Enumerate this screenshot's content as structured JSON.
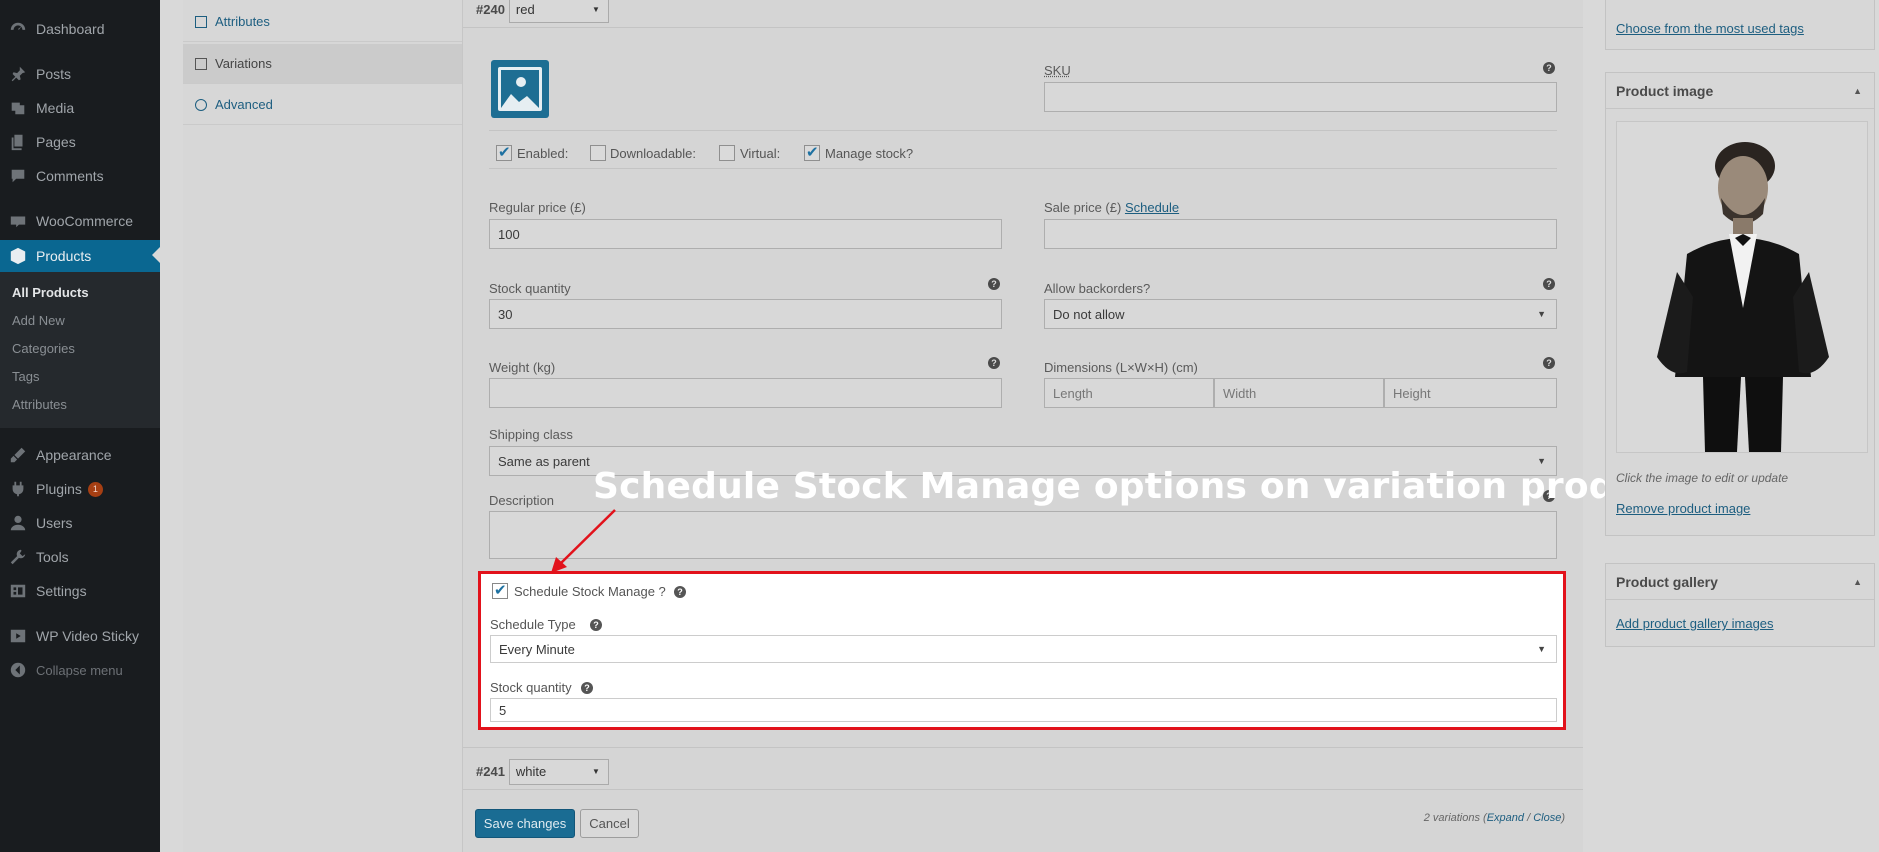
{
  "sidebar": {
    "items": [
      {
        "label": "Dashboard",
        "icon": "dashboard-icon"
      },
      {
        "label": "Posts",
        "icon": "pin-icon"
      },
      {
        "label": "Media",
        "icon": "media-icon"
      },
      {
        "label": "Pages",
        "icon": "pages-icon"
      },
      {
        "label": "Comments",
        "icon": "comments-icon"
      },
      {
        "label": "WooCommerce",
        "icon": "woocommerce-icon"
      },
      {
        "label": "Products",
        "icon": "products-icon"
      }
    ],
    "submenu": [
      "All Products",
      "Add New",
      "Categories",
      "Tags",
      "Attributes"
    ],
    "lower_items": [
      {
        "label": "Appearance",
        "icon": "brush-icon"
      },
      {
        "label": "Plugins",
        "icon": "plugin-icon",
        "badge": "1"
      },
      {
        "label": "Users",
        "icon": "users-icon"
      },
      {
        "label": "Tools",
        "icon": "wrench-icon"
      },
      {
        "label": "Settings",
        "icon": "settings-icon"
      },
      {
        "label": "WP Video Sticky",
        "icon": "video-icon"
      }
    ],
    "collapse_label": "Collapse menu"
  },
  "product_tabs": [
    {
      "label": "Attributes",
      "icon": "list-icon"
    },
    {
      "label": "Variations",
      "icon": "grid-icon"
    },
    {
      "label": "Advanced",
      "icon": "gear-icon"
    }
  ],
  "variation_240": {
    "number": "#240",
    "attribute_value": "red",
    "sku_label": "SKU",
    "sku_value": "",
    "checkboxes": [
      {
        "label": "Enabled:",
        "checked": true
      },
      {
        "label": "Downloadable:",
        "checked": false
      },
      {
        "label": "Virtual:",
        "checked": false
      },
      {
        "label": "Manage stock?",
        "checked": true
      }
    ],
    "regular_price_label": "Regular price (£)",
    "regular_price": "100",
    "sale_price_label": "Sale price (£)",
    "schedule_link": "Schedule",
    "sale_price": "",
    "stock_qty_label": "Stock quantity",
    "stock_qty": "30",
    "backorders_label": "Allow backorders?",
    "backorders_value": "Do not allow",
    "weight_label": "Weight (kg)",
    "weight_value": "",
    "dimensions_label": "Dimensions (L×W×H) (cm)",
    "length_placeholder": "Length",
    "width_placeholder": "Width",
    "height_placeholder": "Height",
    "shipping_label": "Shipping class",
    "shipping_value": "Same as parent",
    "description_label": "Description",
    "description_value": ""
  },
  "schedule": {
    "checkbox_label": "Schedule Stock Manage ?",
    "checked": true,
    "type_label": "Schedule Type",
    "type_value": "Every Minute",
    "stock_label": "Stock quantity",
    "stock_value": "5"
  },
  "annotation_text": "Schedule Stock Manage options on variation product",
  "variation_241": {
    "number": "#241",
    "attribute_value": "white"
  },
  "actions": {
    "save_label": "Save changes",
    "cancel_label": "Cancel",
    "count_text": "2 variations (",
    "expand_label": "Expand",
    "separator": " / ",
    "close_label": "Close",
    "count_end": ")"
  },
  "right": {
    "tags_link": "Choose from the most used tags",
    "product_image_title": "Product image",
    "image_note": "Click the image to edit or update",
    "remove_image_link": "Remove product image",
    "gallery_title": "Product gallery",
    "add_gallery_link": "Add product gallery images"
  },
  "colors": {
    "admin_bar": "#191c1f",
    "active_menu": "#0a6791",
    "highlight_border": "#e2121b",
    "link": "#1d5e80"
  }
}
